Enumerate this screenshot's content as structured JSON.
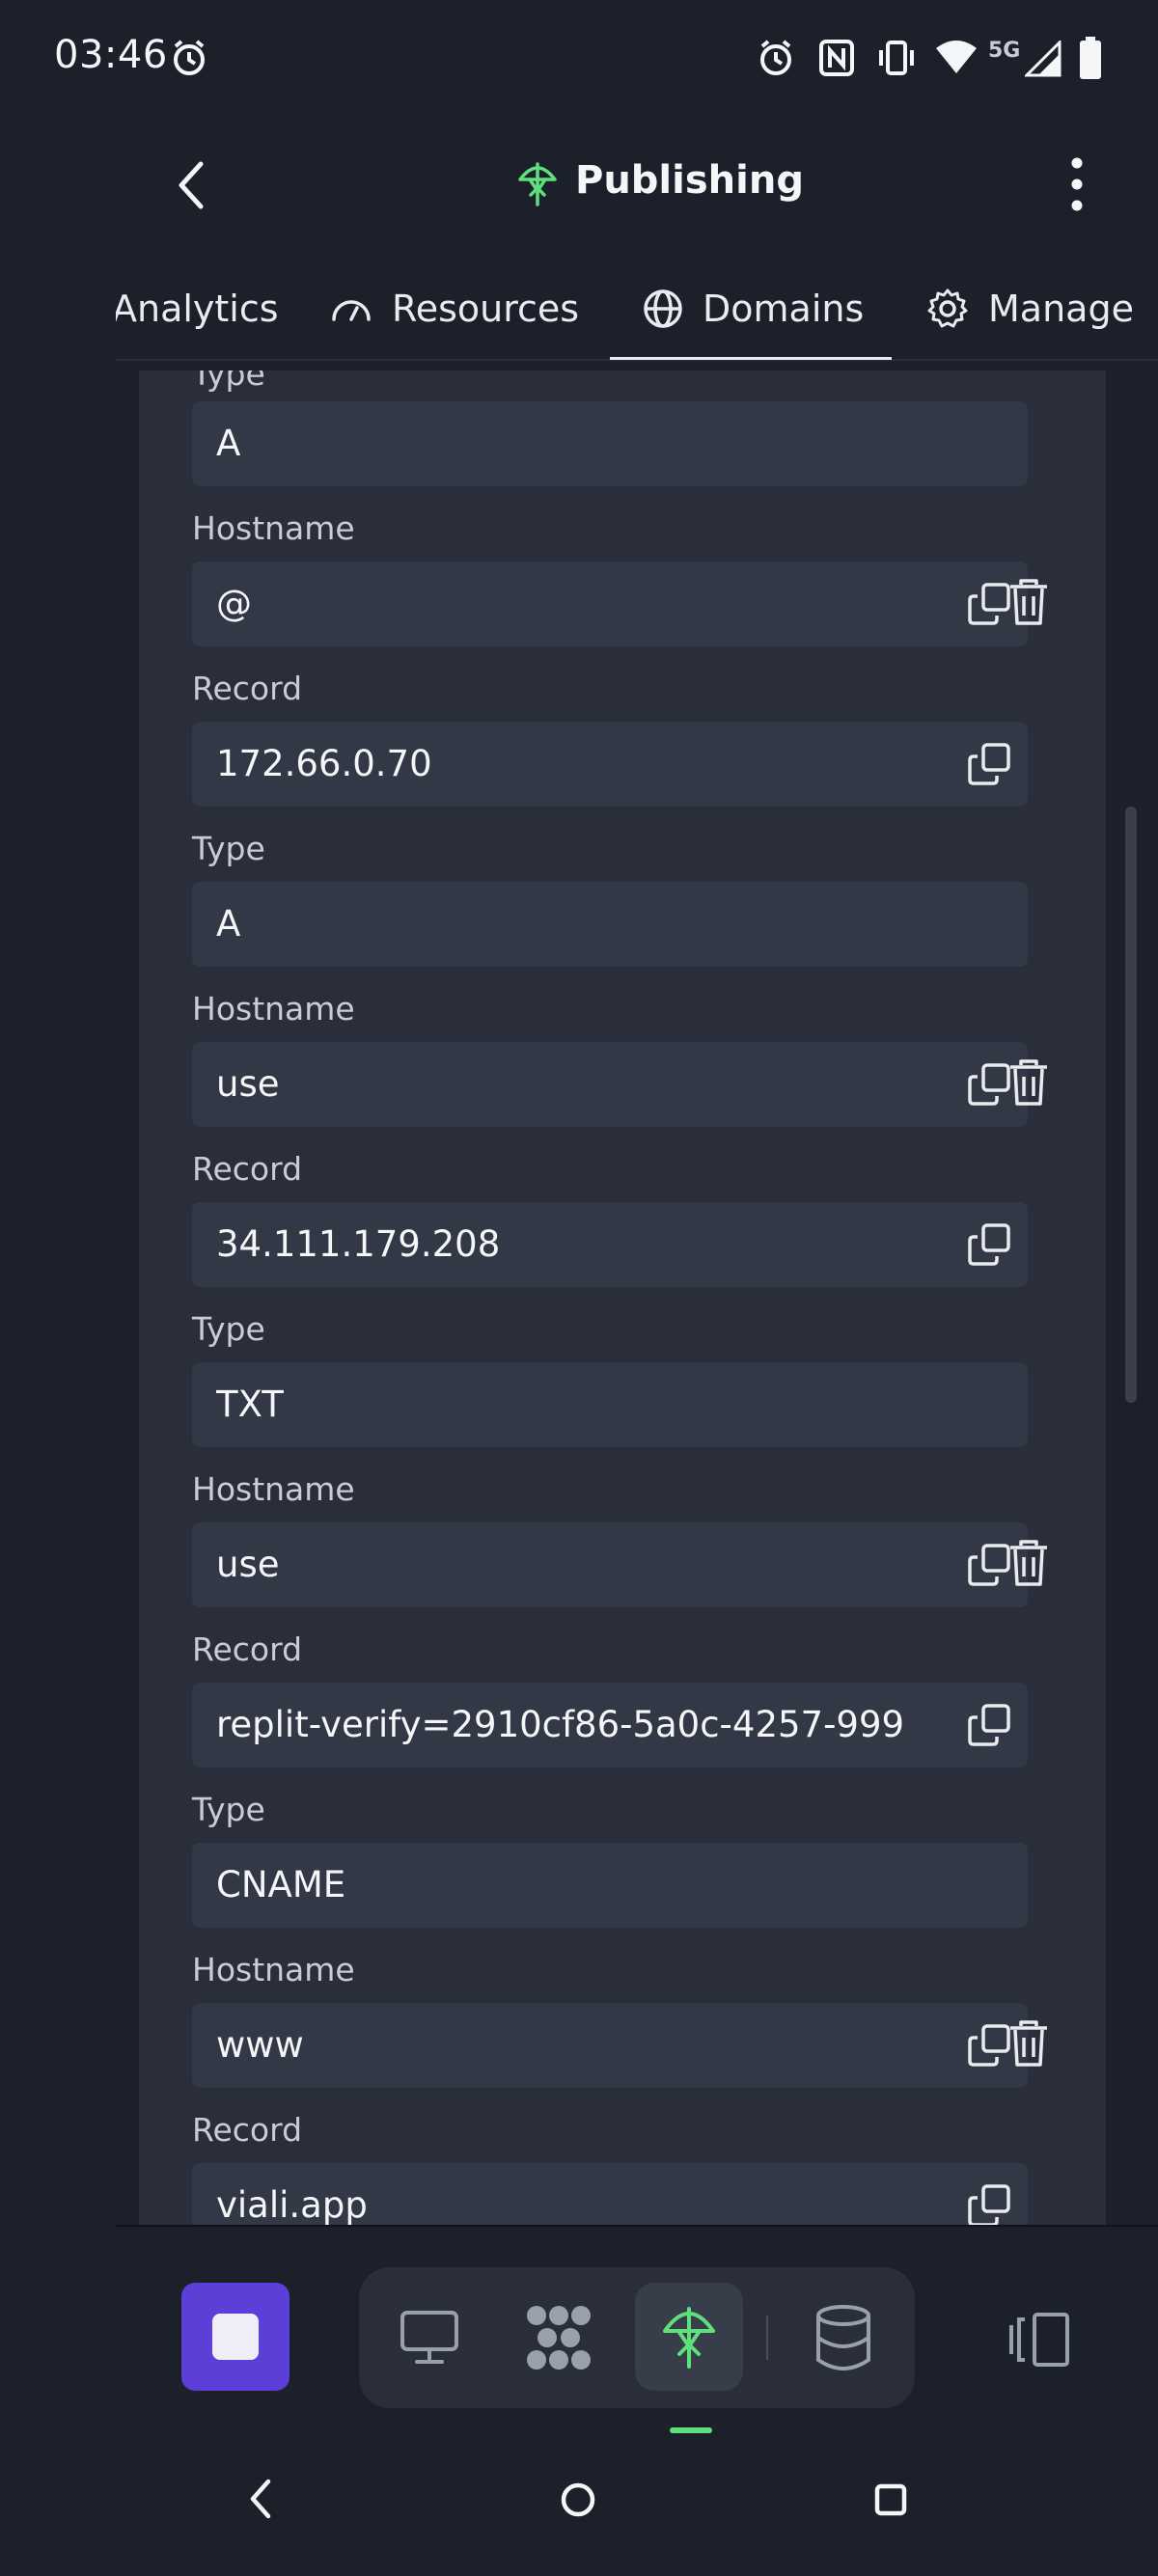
{
  "status_bar": {
    "time": "03:46",
    "network": "5G"
  },
  "header": {
    "title": "Publishing"
  },
  "tabs": [
    {
      "label": "Analytics",
      "icon": "chart-icon"
    },
    {
      "label": "Resources",
      "icon": "gauge-icon"
    },
    {
      "label": "Domains",
      "icon": "globe-icon",
      "active": true
    },
    {
      "label": "Manage",
      "icon": "gear-icon"
    }
  ],
  "records": {
    "top_type_label": "Type",
    "r1": {
      "type_value": "A",
      "hostname_label": "Hostname",
      "hostname": "@",
      "record_label": "Record",
      "record": "172.66.0.70"
    },
    "r2": {
      "type_label": "Type",
      "type_value": "A",
      "hostname_label": "Hostname",
      "hostname": "use",
      "record_label": "Record",
      "record": "34.111.179.208"
    },
    "r3": {
      "type_label": "Type",
      "type_value": "TXT",
      "hostname_label": "Hostname",
      "hostname": "use",
      "record_label": "Record",
      "record": "replit-verify=2910cf86-5a0c-4257-999"
    },
    "r4": {
      "type_label": "Type",
      "type_value": "CNAME",
      "hostname_label": "Hostname",
      "hostname": "www",
      "record_label": "Record",
      "record": "viali.app"
    }
  },
  "colors": {
    "accent_green": "#5ee07c",
    "stop_button": "#5b3fd6",
    "background": "#1c202b",
    "panel": "#2a2e3a",
    "field": "#333846"
  }
}
